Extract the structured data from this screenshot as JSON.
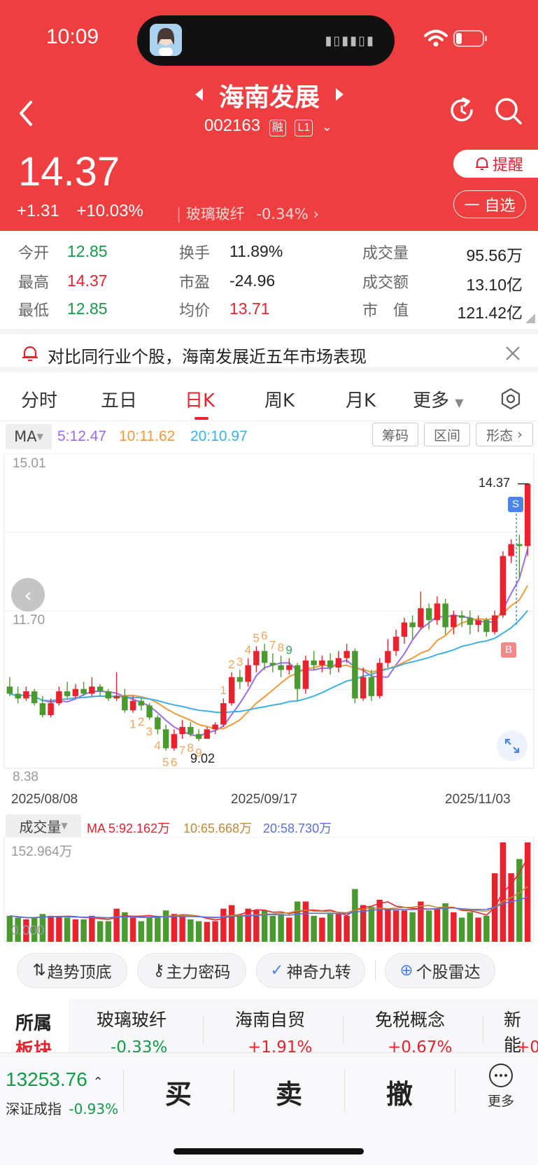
{
  "status": {
    "time": "10:09"
  },
  "header": {
    "name": "海南发展",
    "code": "002163",
    "tag_margin": "融",
    "tag_level": "L1",
    "price": "14.37",
    "change": "+1.31",
    "change_pct": "+10.03%",
    "sector": "玻璃玻纤",
    "sector_pct": "-0.34%",
    "alert_btn": "提醒",
    "watch_btn": "一 自选"
  },
  "quote": {
    "open_label": "今开",
    "open": "12.85",
    "high_label": "最高",
    "high": "14.37",
    "low_label": "最低",
    "low": "12.85",
    "turnover_label": "换手",
    "turnover": "11.89%",
    "pe_label": "市盈",
    "pe": "-24.96",
    "avg_label": "均价",
    "avg": "13.71",
    "vol_label": "成交量",
    "vol": "95.56万",
    "amount_label": "成交额",
    "amount": "13.10亿",
    "mcap_label": "市　值",
    "mcap": "121.42亿"
  },
  "banner": {
    "text": "对比同行业个股，海南发展近五年市场表现"
  },
  "tabs": [
    "分时",
    "五日",
    "日K",
    "周K",
    "月K",
    "更多"
  ],
  "ma_bar": {
    "ma_select": "MA",
    "ma5": "5:12.47",
    "ma10": "10:11.62",
    "ma20": "20:10.97",
    "btn_chips": "筹码",
    "btn_range": "区间",
    "btn_pattern": "形态"
  },
  "chart_labels": {
    "y_top": "15.01",
    "y_mid": "11.70",
    "y_bottom": "8.38",
    "max_label": "14.37",
    "min_label": "9.02",
    "date_left": "2025/08/08",
    "date_mid": "2025/09/17",
    "date_right": "2025/11/03",
    "sell_marker": "S",
    "buy_marker": "B"
  },
  "volume_bar": {
    "select": "成交量",
    "ma5": "MA 5:92.162万",
    "ma10": "10:65.668万",
    "ma20": "20:58.730万",
    "y_max": "152.964万",
    "y_min": "0.000"
  },
  "colors": {
    "up": "#e8232d",
    "down": "#4b9a2f",
    "ma5": "#9b6cf0",
    "ma10": "#f29a3b",
    "ma20": "#3cb0e8",
    "header": "#ee3e3f"
  },
  "chart_data": {
    "type": "candlestick",
    "x_range": [
      "2025/08/08",
      "2025/11/03"
    ],
    "ylim": [
      8.38,
      15.01
    ],
    "candles": [
      [
        10.1,
        9.95,
        10.3,
        9.9
      ],
      [
        9.95,
        9.85,
        10.1,
        9.75
      ],
      [
        9.85,
        10.0,
        10.1,
        9.8
      ],
      [
        10.0,
        9.75,
        10.05,
        9.7
      ],
      [
        9.75,
        9.5,
        9.9,
        9.45
      ],
      [
        9.5,
        9.75,
        9.85,
        9.45
      ],
      [
        9.75,
        10.0,
        10.1,
        9.7
      ],
      [
        10.0,
        9.9,
        10.2,
        9.85
      ],
      [
        9.9,
        10.05,
        10.15,
        9.85
      ],
      [
        10.05,
        9.95,
        10.2,
        9.9
      ],
      [
        9.95,
        10.1,
        10.3,
        9.9
      ],
      [
        10.1,
        10.0,
        10.15,
        9.9
      ],
      [
        10.0,
        9.85,
        10.05,
        9.8
      ],
      [
        9.85,
        9.9,
        10.4,
        9.8
      ],
      [
        9.9,
        9.6,
        10.05,
        9.55
      ],
      [
        9.6,
        9.8,
        9.9,
        9.55
      ],
      [
        9.8,
        9.7,
        9.85,
        9.6
      ],
      [
        9.7,
        9.45,
        9.75,
        9.4
      ],
      [
        9.45,
        9.2,
        9.5,
        9.1
      ],
      [
        9.2,
        8.8,
        9.3,
        8.75
      ],
      [
        8.8,
        9.1,
        9.2,
        8.75
      ],
      [
        9.1,
        9.25,
        9.4,
        9.0
      ],
      [
        9.25,
        9.1,
        9.35,
        9.05
      ],
      [
        9.1,
        9.0,
        9.2,
        8.95
      ],
      [
        9.0,
        9.2,
        9.25,
        9.02
      ],
      [
        9.2,
        9.3,
        9.35,
        9.1
      ],
      [
        9.3,
        9.75,
        9.85,
        9.25
      ],
      [
        9.75,
        10.3,
        10.4,
        9.7
      ],
      [
        10.3,
        10.2,
        10.45,
        10.05
      ],
      [
        10.2,
        10.55,
        10.7,
        10.1
      ],
      [
        10.55,
        10.85,
        10.95,
        10.4
      ],
      [
        10.85,
        10.6,
        11.0,
        10.45
      ],
      [
        10.6,
        10.55,
        10.8,
        10.4
      ],
      [
        10.55,
        10.45,
        10.75,
        10.3
      ],
      [
        10.45,
        10.55,
        10.7,
        10.35
      ],
      [
        10.55,
        10.05,
        10.6,
        9.8
      ],
      [
        10.05,
        10.65,
        10.75,
        9.95
      ],
      [
        10.65,
        10.55,
        10.85,
        10.45
      ],
      [
        10.55,
        10.65,
        10.75,
        10.4
      ],
      [
        10.65,
        10.5,
        10.8,
        10.35
      ],
      [
        10.5,
        10.7,
        10.85,
        10.4
      ],
      [
        10.7,
        10.85,
        11.0,
        10.6
      ],
      [
        10.85,
        9.85,
        10.9,
        9.75
      ],
      [
        9.85,
        10.3,
        10.5,
        9.8
      ],
      [
        10.3,
        9.9,
        10.45,
        9.8
      ],
      [
        9.9,
        10.6,
        10.7,
        9.85
      ],
      [
        10.6,
        10.85,
        11.1,
        10.5
      ],
      [
        10.85,
        11.15,
        11.3,
        10.75
      ],
      [
        11.15,
        11.45,
        11.55,
        11.0
      ],
      [
        11.45,
        11.35,
        11.6,
        11.1
      ],
      [
        11.35,
        11.75,
        12.1,
        11.3
      ],
      [
        11.75,
        11.5,
        11.85,
        11.3
      ],
      [
        11.5,
        11.85,
        12.0,
        11.4
      ],
      [
        11.85,
        11.35,
        11.95,
        11.2
      ],
      [
        11.35,
        11.6,
        11.7,
        11.2
      ],
      [
        11.6,
        11.55,
        11.7,
        11.35
      ],
      [
        11.55,
        11.4,
        11.7,
        11.2
      ],
      [
        11.4,
        11.5,
        11.6,
        11.25
      ],
      [
        11.5,
        11.25,
        11.55,
        11.15
      ],
      [
        11.25,
        11.6,
        11.7,
        11.2
      ],
      [
        11.6,
        12.85,
        12.95,
        11.55
      ],
      [
        12.85,
        13.1,
        13.2,
        12.7
      ],
      [
        13.1,
        13.06,
        13.3,
        12.4
      ],
      [
        13.06,
        14.37,
        14.37,
        12.85
      ]
    ],
    "volume_max": 152.964,
    "volume_min": 0.0
  },
  "chips": [
    "趋势顶底",
    "主力密码",
    "神奇九转",
    "个股雷达"
  ],
  "sector_row": {
    "label_line1": "所属",
    "label_line2": "板块",
    "items": [
      {
        "name": "玻璃玻纤",
        "pct": "-0.33%"
      },
      {
        "name": "海南自贸",
        "pct": "+1.91%"
      },
      {
        "name": "免税概念",
        "pct": "+0.67%"
      },
      {
        "name": "新能",
        "pct": "+0"
      }
    ]
  },
  "bottom": {
    "index_value": "13253.76",
    "index_name": "深证成指",
    "index_pct": "-0.93%",
    "buy": "买",
    "sell": "卖",
    "cancel": "撤",
    "more": "更多"
  }
}
